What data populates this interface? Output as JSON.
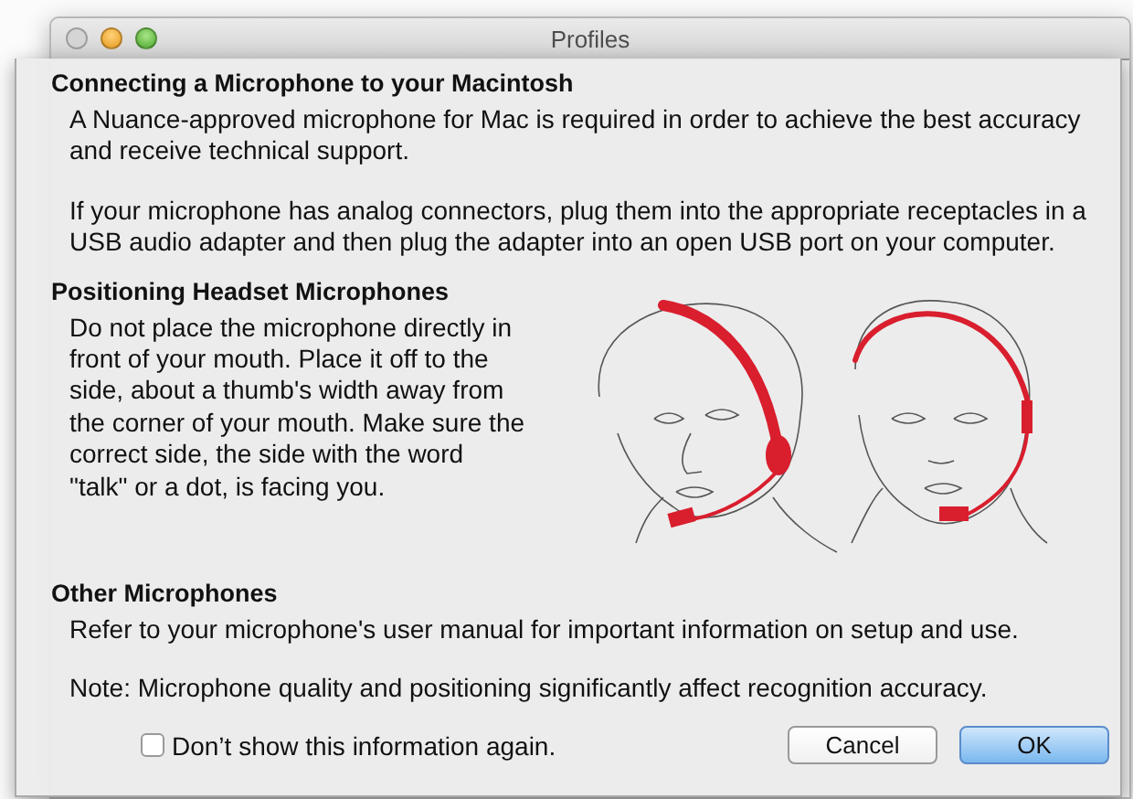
{
  "window": {
    "title": "Profiles"
  },
  "sections": [
    {
      "kind": "text",
      "heading": "Connecting a Microphone to your Macintosh",
      "paragraphs": [
        "A Nuance-approved microphone for Mac is required in order to achieve the best accuracy and receive technical support.",
        "If your microphone has analog connectors, plug them into the appropriate receptacles in a USB audio adapter and then plug the adapter into an open USB port on your computer."
      ]
    },
    {
      "kind": "illustrated",
      "heading": "Positioning Headset Microphones",
      "paragraphs": [
        "Do not place the microphone directly in front of your mouth. Place it off to the side, about a thumb's width away from the corner of your mouth. Make sure the correct side, the side with the word \"talk\" or a dot, is facing you."
      ]
    },
    {
      "kind": "text",
      "heading": "Other Microphones",
      "paragraphs": [
        "Refer to your microphone's user manual for important information on setup and use.",
        "Note: Microphone quality and positioning significantly affect recognition accuracy."
      ]
    }
  ],
  "dont_show_again": {
    "label": "Don’t show this information again.",
    "checked": false
  },
  "buttons": [
    {
      "label": "Cancel",
      "default": false
    },
    {
      "label": "OK",
      "default": true
    }
  ]
}
